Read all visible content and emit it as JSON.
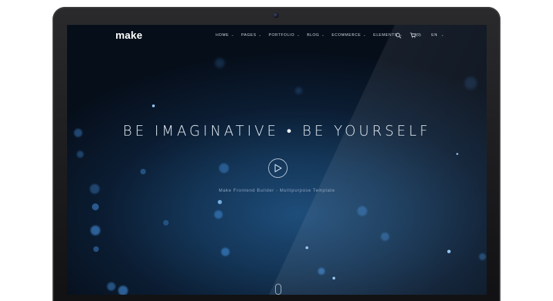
{
  "site": {
    "logo": "make",
    "nav": [
      {
        "label": "HOME"
      },
      {
        "label": "PAGES"
      },
      {
        "label": "PORTFOLIO"
      },
      {
        "label": "BLOG"
      },
      {
        "label": "ECOMMERCE"
      },
      {
        "label": "ELEMENTS"
      }
    ],
    "search_icon": "search-icon",
    "cart": {
      "icon": "cart-icon",
      "count": "(0)"
    },
    "language": "EN"
  },
  "hero": {
    "headline": "BE IMAGINATIVE • BE YOURSELF",
    "play_icon": "play-icon",
    "subtitle": "Make Frontend Builder - Multipurpose Template"
  },
  "colors": {
    "background": "#0b1d33",
    "accent": "#4fa6ff",
    "device_frame": "#1c1c1e"
  }
}
